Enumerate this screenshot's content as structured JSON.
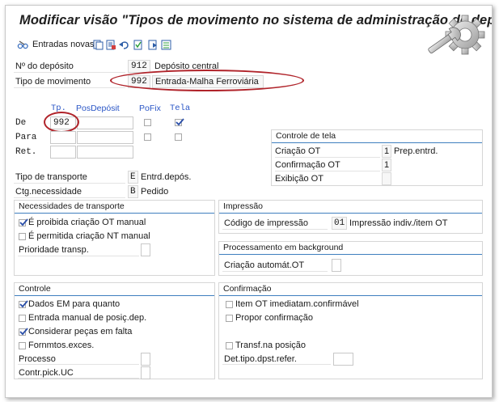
{
  "title": "Modificar visão \"Tipos de movimento no sistema de administração de dep",
  "toolbar": {
    "entradas_novas": "Entradas novas"
  },
  "header": {
    "deposito_label": "Nº do depósito",
    "deposito_value": "912",
    "deposito_desc": "Depósito central",
    "tipo_mov_label": "Tipo de movimento",
    "tipo_mov_value": "992",
    "tipo_mov_desc": "Entrada-Malha Ferroviária"
  },
  "grid": {
    "col_tp": "Tp.",
    "col_posdeposit": "PosDepósit",
    "col_pofix": "PoFix",
    "col_tela": "Tela",
    "row_de": "De",
    "row_para": "Para",
    "row_ret": "Ret.",
    "de_tp": "992"
  },
  "controle_tela": {
    "title": "Controle de tela",
    "criacao_label": "Criação OT",
    "criacao_value": "1",
    "criacao_desc": "Prep.entrd.",
    "confirmacao_label": "Confirmação OT",
    "confirmacao_value": "1",
    "exibicao_label": "Exibição OT"
  },
  "transporte": {
    "tipo_label": "Tipo de transporte",
    "tipo_value": "E",
    "tipo_desc": "Entrd.depós.",
    "ctg_label": "Ctg.necessidade",
    "ctg_value": "B",
    "ctg_desc": "Pedido"
  },
  "necessidades": {
    "title": "Necessidades de transporte",
    "proibida": "É proibida criação OT manual",
    "permitida": "É permitida criação NT manual",
    "prioridade": "Prioridade transp."
  },
  "impressao": {
    "title": "Impressão",
    "codigo_label": "Código de impressão",
    "codigo_value": "01",
    "codigo_desc": "Impressão indiv./item OT"
  },
  "background": {
    "title": "Processamento em background",
    "criacao_label": "Criação automát.OT"
  },
  "controle": {
    "title": "Controle",
    "dados_em": "Dados EM para quanto",
    "entrada_manual": "Entrada manual de posiç.dep.",
    "considerar": "Considerar peças em falta",
    "fornmtos": "Fornmtos.exces.",
    "processo": "Processo",
    "contr_pick": "Contr.pick.UC"
  },
  "confirmacao": {
    "title": "Confirmação",
    "item_ot": "Item OT imediatam.confirmável",
    "propor": "Propor confirmação",
    "transf": "Transf.na posição",
    "det_tipo": "Det.tipo.dpst.refer."
  }
}
